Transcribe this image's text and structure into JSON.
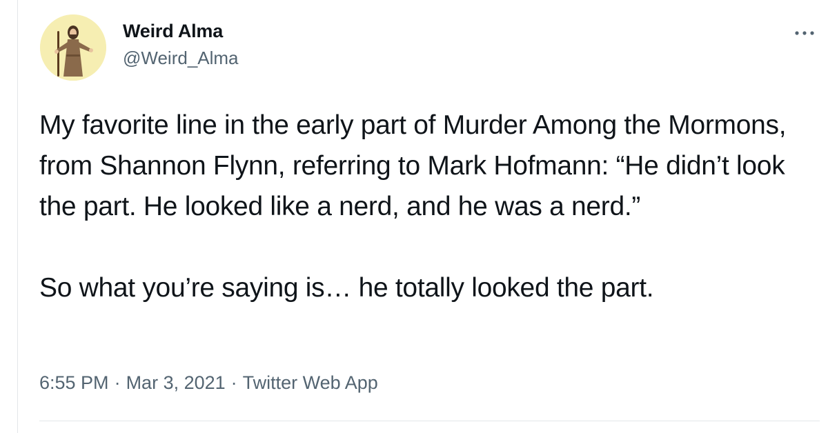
{
  "tweet": {
    "author": {
      "display_name": "Weird Alma",
      "handle": "@Weird_Alma",
      "avatar_icon": "robed-figure-with-staff-icon"
    },
    "more_icon": "more-options-icon",
    "text": {
      "paragraph_1": "My favorite line in the early part of Murder Among the Mormons, from Shannon Flynn, referring to Mark Hofmann: “He didn’t look the part. He looked like a nerd, and he was a nerd.”",
      "paragraph_2": "So what you’re saying is… he totally looked the part."
    },
    "meta": {
      "time": "6:55 PM",
      "separator": "·",
      "date": "Mar 3, 2021",
      "source": "Twitter Web App"
    }
  },
  "colors": {
    "text_primary": "#0f1419",
    "text_secondary": "#536471",
    "divider": "#e3e6e8",
    "avatar_background": "#f6eeb2"
  }
}
